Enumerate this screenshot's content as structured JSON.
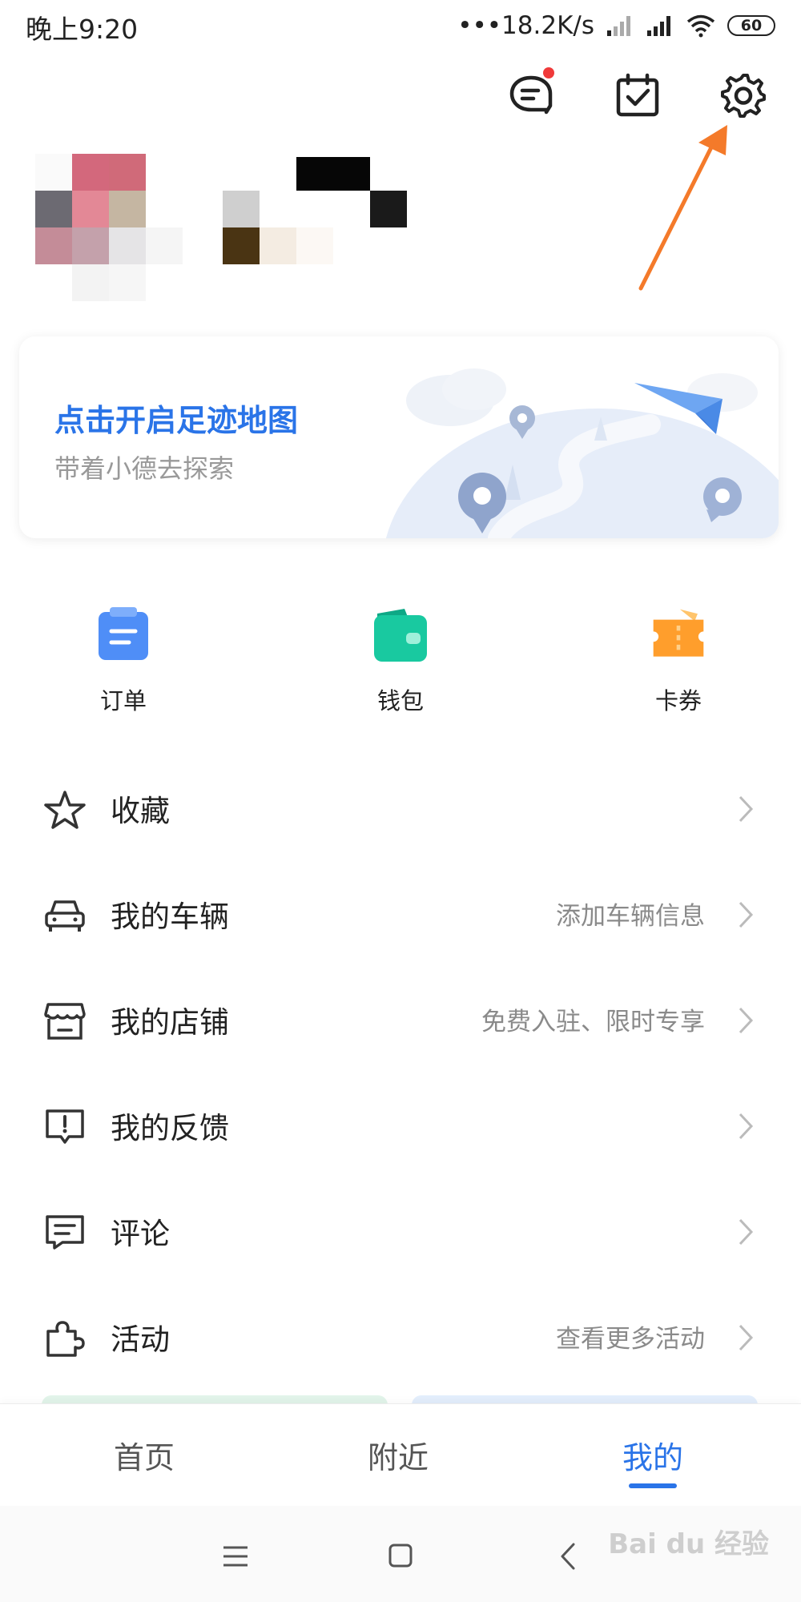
{
  "status_bar": {
    "time": "晚上9:20",
    "net_speed": "•••18.2K/s",
    "battery": "60"
  },
  "header_icons": {
    "message_icon": "chat-bubble-icon",
    "checkin_icon": "calendar-check-icon",
    "settings_icon": "gear-icon",
    "message_has_badge": true
  },
  "footprint_card": {
    "title": "点击开启足迹地图",
    "subtitle": "带着小德去探索"
  },
  "quick_entries": [
    {
      "label": "订单",
      "icon": "order-clipboard-icon",
      "color": "#4f8ef7"
    },
    {
      "label": "钱包",
      "icon": "wallet-icon",
      "color": "#19c9a0"
    },
    {
      "label": "卡券",
      "icon": "coupon-ticket-icon",
      "color": "#ff9e2c"
    }
  ],
  "menu": [
    {
      "label": "收藏",
      "hint": "",
      "icon": "star-icon"
    },
    {
      "label": "我的车辆",
      "hint": "添加车辆信息",
      "icon": "car-icon"
    },
    {
      "label": "我的店铺",
      "hint": "免费入驻、限时专享",
      "icon": "store-icon"
    },
    {
      "label": "我的反馈",
      "hint": "",
      "icon": "feedback-icon"
    },
    {
      "label": "评论",
      "hint": "",
      "icon": "comment-icon"
    },
    {
      "label": "活动",
      "hint": "查看更多活动",
      "icon": "puzzle-icon"
    }
  ],
  "tabs": [
    {
      "label": "首页",
      "active": false
    },
    {
      "label": "附近",
      "active": false
    },
    {
      "label": "我的",
      "active": true
    }
  ],
  "watermark": "Bai du 经验",
  "colors": {
    "accent": "#2a74e8",
    "annotation_arrow": "#f47a2a",
    "badge_red": "#f03a3a"
  }
}
